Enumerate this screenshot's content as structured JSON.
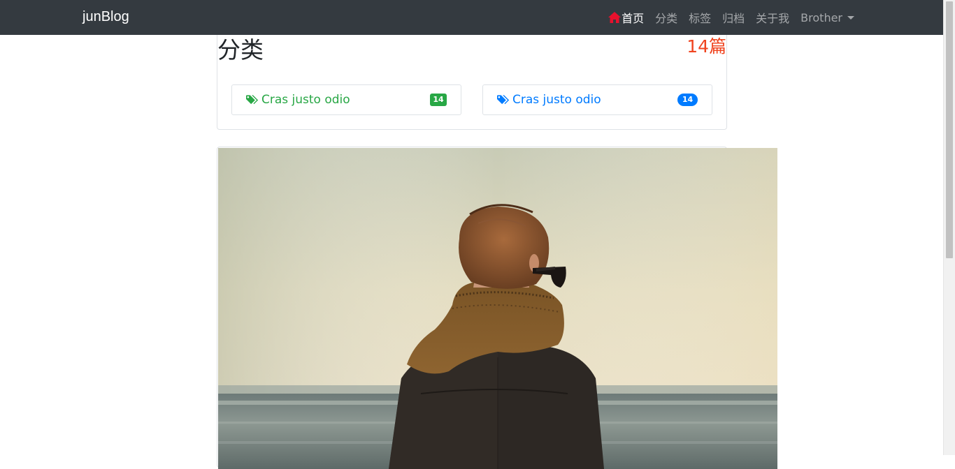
{
  "navbar": {
    "brand": "junBlog",
    "items": [
      {
        "label": "首页",
        "active": true,
        "icon": "home-icon"
      },
      {
        "label": "分类"
      },
      {
        "label": "标签"
      },
      {
        "label": "归档"
      },
      {
        "label": "关于我"
      },
      {
        "label": "Brother",
        "dropdown": true
      }
    ]
  },
  "category_card": {
    "title": "分类",
    "count": "14篇",
    "items": [
      {
        "label": "Cras justo odio",
        "count": "14",
        "color": "#28a745",
        "icon": "tags-icon"
      },
      {
        "label": "Cras justo odio",
        "count": "14",
        "color": "#007bff",
        "icon": "tags-icon"
      }
    ]
  },
  "post": {
    "image": "person-with-scarf-and-sunglasses-facing-sea-photo"
  },
  "colors": {
    "navbar_bg": "#343a40",
    "count_accent": "#f0441f",
    "home_icon": "#e8112d"
  }
}
